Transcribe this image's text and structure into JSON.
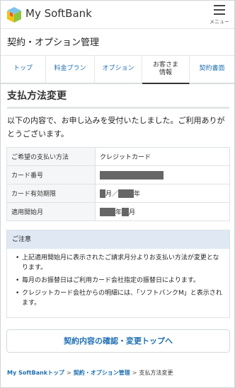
{
  "header": {
    "brand": "My SoftBank",
    "menu_label": "メニュー"
  },
  "section_title": "契約・オプション管理",
  "tabs": [
    {
      "label": "トップ"
    },
    {
      "label": "料金プラン"
    },
    {
      "label": "オプション"
    },
    {
      "label": "お客さま\n情報",
      "active": true
    },
    {
      "label": "契約書面"
    }
  ],
  "page": {
    "heading": "支払方法変更",
    "message": "以下の内容で、お申し込みを受付いたしました。ご利用ありがとうございます。"
  },
  "info_table": {
    "method_label": "ご希望の支払い方法",
    "method_value": "クレジットカード",
    "card_label": "カード番号",
    "expiry_label": "カード有効期限",
    "expiry_month_unit": "月／",
    "expiry_year_unit": "年",
    "start_label": "適用開始月",
    "start_year_unit": "年",
    "start_month_unit": "月"
  },
  "notice": {
    "title": "ご注意",
    "items": [
      "上記適用開始月に表示されたご請求月分よりお支払い方法が変更となります。",
      "毎月のお振替日はご利用カード会社指定の振替日によります。",
      "クレジットカード会社からの明細には、「ソフトバンクM」と表示されます。"
    ]
  },
  "cta_label": "契約内容の確認・変更トップへ",
  "breadcrumb": {
    "item1": "My SoftBankトップ",
    "item2": "契約・オプション管理",
    "item3": "支払方法変更",
    "separator": ">"
  },
  "colors": {
    "link": "#1f6fb2",
    "notice_header": "#dfe8f3"
  }
}
